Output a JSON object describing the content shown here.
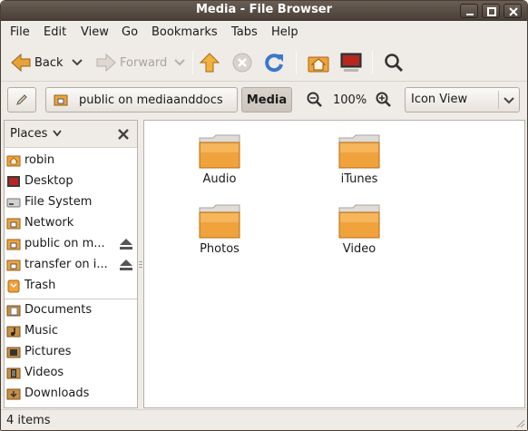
{
  "window": {
    "title": "Media - File Browser"
  },
  "menubar": {
    "items": [
      "File",
      "Edit",
      "View",
      "Go",
      "Bookmarks",
      "Tabs",
      "Help"
    ]
  },
  "toolbar": {
    "back_label": "Back",
    "forward_label": "Forward"
  },
  "location": {
    "path_buttons": [
      "public on mediaanddocs",
      "Media"
    ],
    "zoom": "100%",
    "view_mode": "Icon View"
  },
  "sidebar": {
    "header": "Places",
    "items": [
      {
        "label": "robin",
        "icon": "home-folder-icon"
      },
      {
        "label": "Desktop",
        "icon": "desktop-icon"
      },
      {
        "label": "File System",
        "icon": "drive-icon"
      },
      {
        "label": "Network",
        "icon": "network-folder-icon"
      },
      {
        "label": "public on m...",
        "icon": "network-share-icon",
        "eject": true
      },
      {
        "label": "transfer on i...",
        "icon": "network-share-icon",
        "eject": true
      },
      {
        "label": "Trash",
        "icon": "trash-icon"
      }
    ],
    "bookmarks": [
      {
        "label": "Documents",
        "icon": "documents-folder-icon"
      },
      {
        "label": "Music",
        "icon": "music-folder-icon"
      },
      {
        "label": "Pictures",
        "icon": "pictures-folder-icon"
      },
      {
        "label": "Videos",
        "icon": "videos-folder-icon"
      },
      {
        "label": "Downloads",
        "icon": "downloads-folder-icon"
      }
    ]
  },
  "files": [
    {
      "name": "Audio"
    },
    {
      "name": "iTunes"
    },
    {
      "name": "Photos"
    },
    {
      "name": "Video"
    }
  ],
  "status": {
    "text": "4 items"
  },
  "colors": {
    "accent": "#e38c2c",
    "folder": "#f0a23c",
    "titlebar": "#4a4038"
  }
}
